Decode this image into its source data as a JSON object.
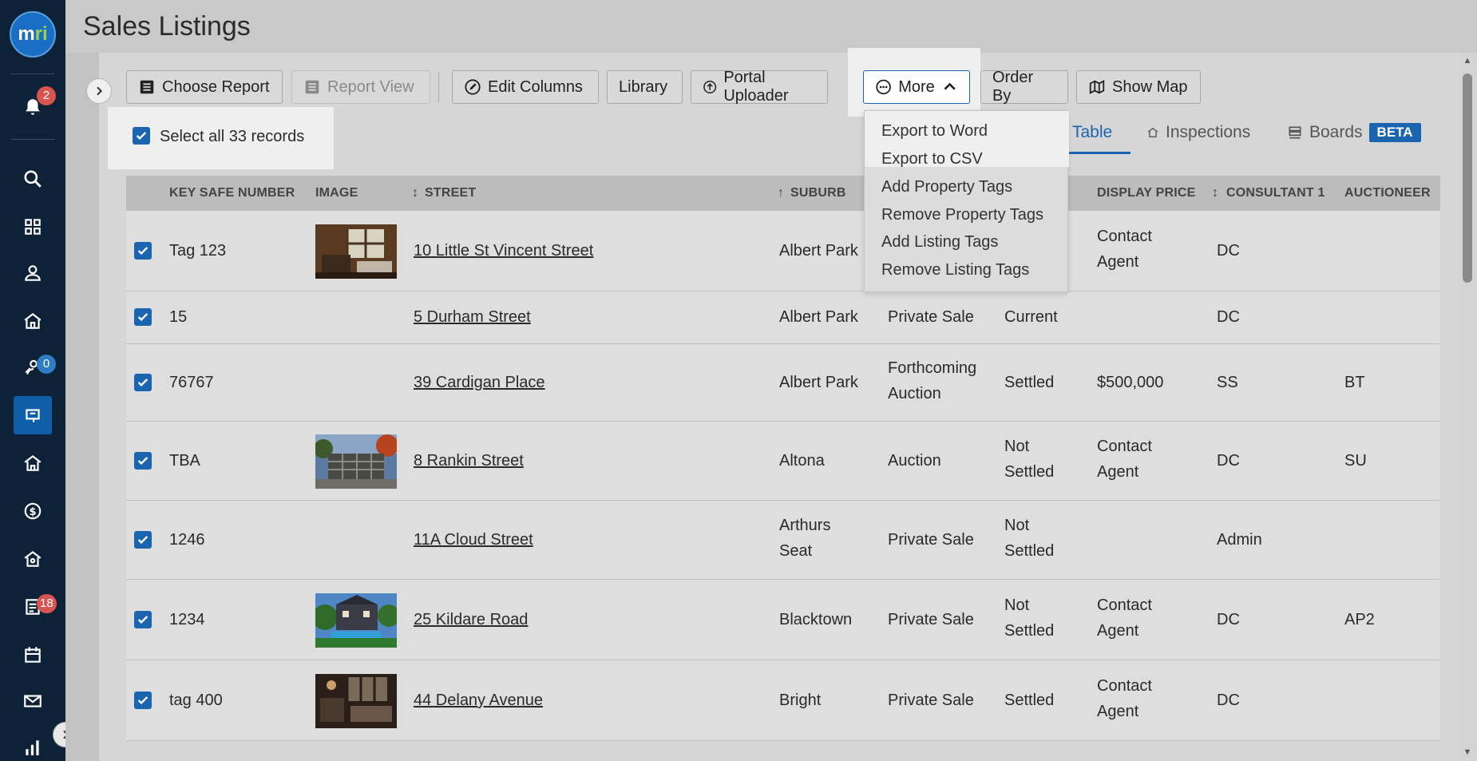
{
  "app": {
    "logo_text": "mri",
    "page_title": "Sales Listings"
  },
  "nav": {
    "notifications_badge": "2",
    "inbox_badge": "0",
    "tasks_badge": "18",
    "items": [
      "search-icon",
      "dashboard-icon",
      "contacts-icon",
      "properties-icon",
      "prospects-icon",
      "listings-icon",
      "rentals-icon",
      "finance-icon",
      "management-icon",
      "reports-icon",
      "calendar-icon",
      "mail-icon",
      "analytics-icon"
    ]
  },
  "toolbar": {
    "choose_report": "Choose Report",
    "report_view": "Report View",
    "edit_columns": "Edit Columns",
    "library": "Library",
    "portal_uploader": "Portal Uploader",
    "more": "More",
    "order_by": "Order By",
    "show_map": "Show Map"
  },
  "select_all": {
    "label": "Select all 33 records",
    "checked": true
  },
  "view_tabs": {
    "table": "Table",
    "inspections": "Inspections",
    "boards": "Boards",
    "beta": "BETA"
  },
  "more_menu": {
    "items": [
      "Export to Word",
      "Export to CSV",
      "Add Property Tags",
      "Remove Property Tags",
      "Add Listing Tags",
      "Remove Listing Tags"
    ]
  },
  "table": {
    "headers": {
      "key_safe": "KEY SAFE NUMBER",
      "image": "IMAGE",
      "street": "STREET",
      "suburb": "SUBURB",
      "display_price": "DISPLAY PRICE",
      "consultant": "CONSULTANT 1",
      "auctioneer": "AUCTIONEER"
    },
    "rows": [
      {
        "key": "Tag 123",
        "street": "10 Little St Vincent Street",
        "suburb": "Albert Park",
        "method": "",
        "status": "",
        "price": "Contact Agent",
        "consultant": "DC",
        "auctioneer": ""
      },
      {
        "key": "15",
        "street": "5 Durham Street",
        "suburb": "Albert Park",
        "method": "Private Sale",
        "status": "Current",
        "price": "",
        "consultant": "DC",
        "auctioneer": ""
      },
      {
        "key": "76767",
        "street": "39 Cardigan Place",
        "suburb": "Albert Park",
        "method": "Forthcoming Auction",
        "status": "Settled",
        "price": "$500,000",
        "consultant": "SS",
        "auctioneer": "BT"
      },
      {
        "key": "TBA",
        "street": "8 Rankin Street",
        "suburb": "Altona",
        "method": "Auction",
        "status": "Not Settled",
        "price": "Contact Agent",
        "consultant": "DC",
        "auctioneer": "SU"
      },
      {
        "key": "1246",
        "street": "11A Cloud Street",
        "suburb": "Arthurs Seat",
        "method": "Private Sale",
        "status": "Not Settled",
        "price": "",
        "consultant": "Admin",
        "auctioneer": ""
      },
      {
        "key": "1234",
        "street": "25 Kildare Road",
        "suburb": "Blacktown",
        "method": "Private Sale",
        "status": "Not Settled",
        "price": "Contact Agent",
        "consultant": "DC",
        "auctioneer": "AP2"
      },
      {
        "key": "tag 400",
        "street": "44 Delany Avenue",
        "suburb": "Bright",
        "method": "Private Sale",
        "status": "Settled",
        "price": "Contact Agent",
        "consultant": "DC",
        "auctioneer": ""
      }
    ]
  },
  "colors": {
    "nav_bg": "#0d2137",
    "accent": "#1a64b0",
    "badge_red": "#d9534f"
  }
}
